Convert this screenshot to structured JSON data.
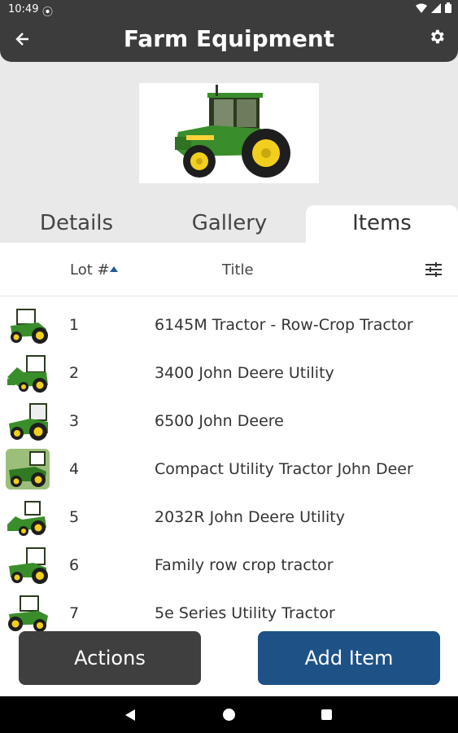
{
  "status_bar": {
    "time": "10:49",
    "icons": [
      "sync-icon",
      "wifi-icon",
      "signal-icon",
      "battery-icon"
    ]
  },
  "app_bar": {
    "title": "Farm Equipment",
    "back_icon": "arrow-back-icon",
    "settings_icon": "gear-icon"
  },
  "tabs": [
    {
      "label": "Details",
      "active": false
    },
    {
      "label": "Gallery",
      "active": false
    },
    {
      "label": "Items",
      "active": true
    }
  ],
  "list": {
    "columns": {
      "lot": "Lot #",
      "title": "Title"
    },
    "sort": {
      "column": "lot",
      "direction": "ascending"
    },
    "items": [
      {
        "lot": "1",
        "title": "6145M Tractor - Row-Crop Tractor"
      },
      {
        "lot": "2",
        "title": "3400 John Deere Utility"
      },
      {
        "lot": "3",
        "title": "6500 John Deere"
      },
      {
        "lot": "4",
        "title": "Compact Utility Tractor John Deer"
      },
      {
        "lot": "5",
        "title": "2032R John Deere Utility"
      },
      {
        "lot": "6",
        "title": "Family row crop tractor"
      },
      {
        "lot": "7",
        "title": "5e Series Utility Tractor"
      }
    ]
  },
  "buttons": {
    "actions": "Actions",
    "add_item": "Add Item"
  },
  "colors": {
    "app_bar": "#3c3c3c",
    "tractor_green": "#3a8d2b",
    "tractor_yellow": "#f2cf1c",
    "add_item_button": "#1e5287",
    "actions_button": "#3f3f3f"
  }
}
